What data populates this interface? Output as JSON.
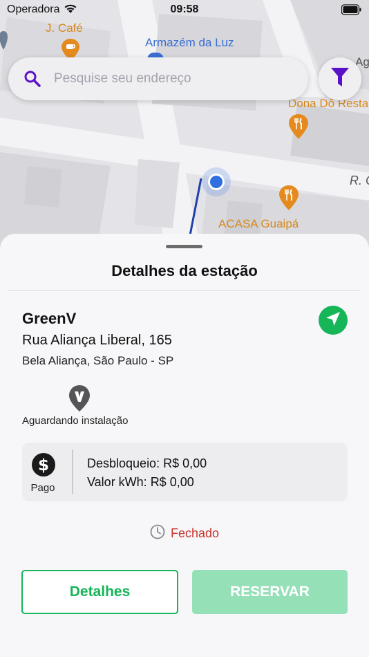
{
  "status_bar": {
    "carrier": "Operadora",
    "time": "09:58"
  },
  "map": {
    "places": {
      "cafe": "J. Café",
      "armazem": "Armazém da Luz",
      "dona": "Dona Dô Resta",
      "acasa": "ACASA Guaipá",
      "street": "R. C",
      "edge": "Ag"
    },
    "icons": [
      "coffee-icon",
      "restaurant-icon",
      "user-location-icon"
    ]
  },
  "search": {
    "placeholder": "Pesquise seu endereço"
  },
  "sheet": {
    "title": "Detalhes da estação",
    "station": {
      "name": "GreenV",
      "address": "Rua Aliança Liberal, 165",
      "city": "Bela Aliança, São Paulo - SP",
      "install_status": "Aguardando instalação"
    },
    "pricing": {
      "type": "Pago",
      "unlock": "Desbloqueio: R$ 0,00",
      "kwh": "Valor kWh: R$ 0,00"
    },
    "open_status": "Fechado",
    "buttons": {
      "details": "Detalhes",
      "reserve": "RESERVAR"
    }
  },
  "colors": {
    "accent_green": "#16b558",
    "disabled_green": "#96e0b8",
    "closed_red": "#c7352e",
    "filter_purple": "#5a12c8"
  }
}
